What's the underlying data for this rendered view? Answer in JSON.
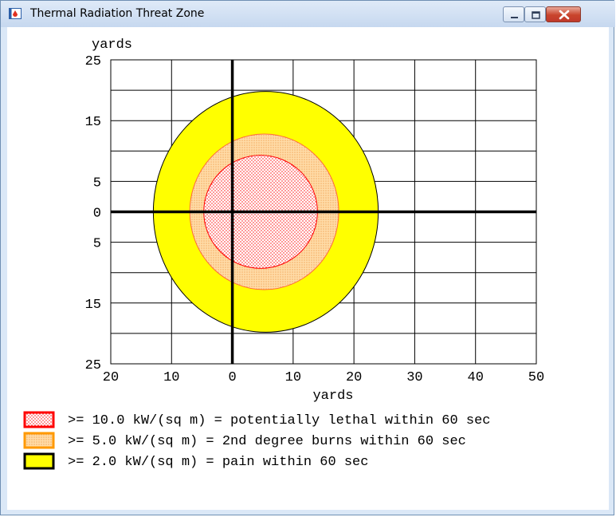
{
  "window": {
    "title": "Thermal Radiation Threat Zone",
    "controls": {
      "minimize": "minimize",
      "maximize": "maximize",
      "close": "close"
    }
  },
  "chart_data": {
    "type": "area",
    "ylabel": "yards",
    "xlabel": "yards",
    "xlim": [
      -20,
      50
    ],
    "ylim": [
      -25,
      25
    ],
    "x_ticks": [
      -20,
      -10,
      0,
      10,
      20,
      30,
      40,
      50
    ],
    "x_tick_labels": [
      "20",
      "10",
      "0",
      "10",
      "20",
      "30",
      "40",
      "50"
    ],
    "y_ticks": [
      25,
      15,
      5,
      0,
      -5,
      -15,
      -25
    ],
    "y_tick_labels": [
      "25",
      "15",
      "5",
      "0",
      "5",
      "15",
      "25"
    ],
    "grid_x": [
      -20,
      -10,
      0,
      10,
      20,
      30,
      40,
      50
    ],
    "grid_y": [
      25,
      20,
      15,
      10,
      5,
      0,
      -5,
      -10,
      -15,
      -20,
      -25
    ],
    "grid": true,
    "legend_position": "bottom",
    "series": [
      {
        "name": ">= 2.0 kW/(sq m) = pain within 60 sec",
        "center_x": 4.0,
        "x_min": -13.0,
        "x_max": 24.0,
        "y_max": 19.8,
        "y_min": -19.8,
        "fill": "#ffff00",
        "edge": "#000000",
        "pattern": "solid"
      },
      {
        "name": ">= 5.0 kW/(sq m) = 2nd degree burns within 60 sec",
        "center_x": 4.0,
        "x_min": -7.0,
        "x_max": 17.5,
        "y_max": 12.8,
        "y_min": -12.8,
        "fill": "#ffc880",
        "edge": "#ff6a3a",
        "pattern": "dots"
      },
      {
        "name": ">= 10.0 kW/(sq m) = potentially lethal within 60 sec",
        "center_x": 4.0,
        "x_min": -4.7,
        "x_max": 14.0,
        "y_max": 9.3,
        "y_min": -9.3,
        "fill": "#ff0000",
        "edge": "#ff0000",
        "pattern": "dots"
      }
    ],
    "legend": [
      {
        "label": ">= 10.0 kW/(sq m) = potentially lethal within 60 sec",
        "swatch_border": "#ff0000",
        "swatch_pattern": "red-dots"
      },
      {
        "label": ">= 5.0 kW/(sq m) = 2nd degree burns within 60 sec",
        "swatch_border": "#ff9900",
        "swatch_pattern": "orange-dots"
      },
      {
        "label": ">= 2.0 kW/(sq m) = pain within 60 sec",
        "swatch_border": "#000000",
        "swatch_pattern": "yellow-solid"
      }
    ]
  }
}
